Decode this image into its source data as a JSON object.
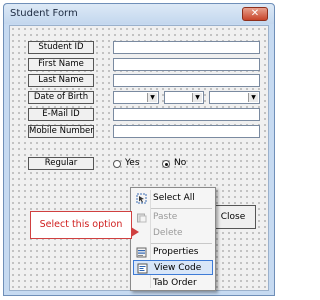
{
  "window": {
    "title": "Student Form",
    "close_symbol": "✕"
  },
  "form": {
    "labels": [
      "Student ID",
      "First Name",
      "Last Name",
      "Date of Birth",
      "E-Mail ID",
      "Mobile Number",
      "Regular"
    ],
    "radio_options": [
      {
        "label": "Yes",
        "selected": false
      },
      {
        "label": "No",
        "selected": true
      }
    ],
    "combo_arrow": "▼",
    "close_button_label": "Close"
  },
  "context_menu": {
    "items": [
      {
        "label": "Select All",
        "enabled": true,
        "icon": "select-all-icon"
      },
      {
        "label": "Paste",
        "enabled": false,
        "icon": "paste-icon"
      },
      {
        "label": "Delete",
        "enabled": false,
        "icon": "delete-icon"
      },
      {
        "label": "Properties",
        "enabled": true,
        "icon": "properties-icon"
      },
      {
        "label": "View Code",
        "enabled": true,
        "highlighted": true,
        "icon": "view-code-icon"
      },
      {
        "label": "Tab Order",
        "enabled": true,
        "icon": "tab-order-icon"
      }
    ]
  },
  "callout": {
    "text": "Select this option",
    "color": "#d04040"
  }
}
